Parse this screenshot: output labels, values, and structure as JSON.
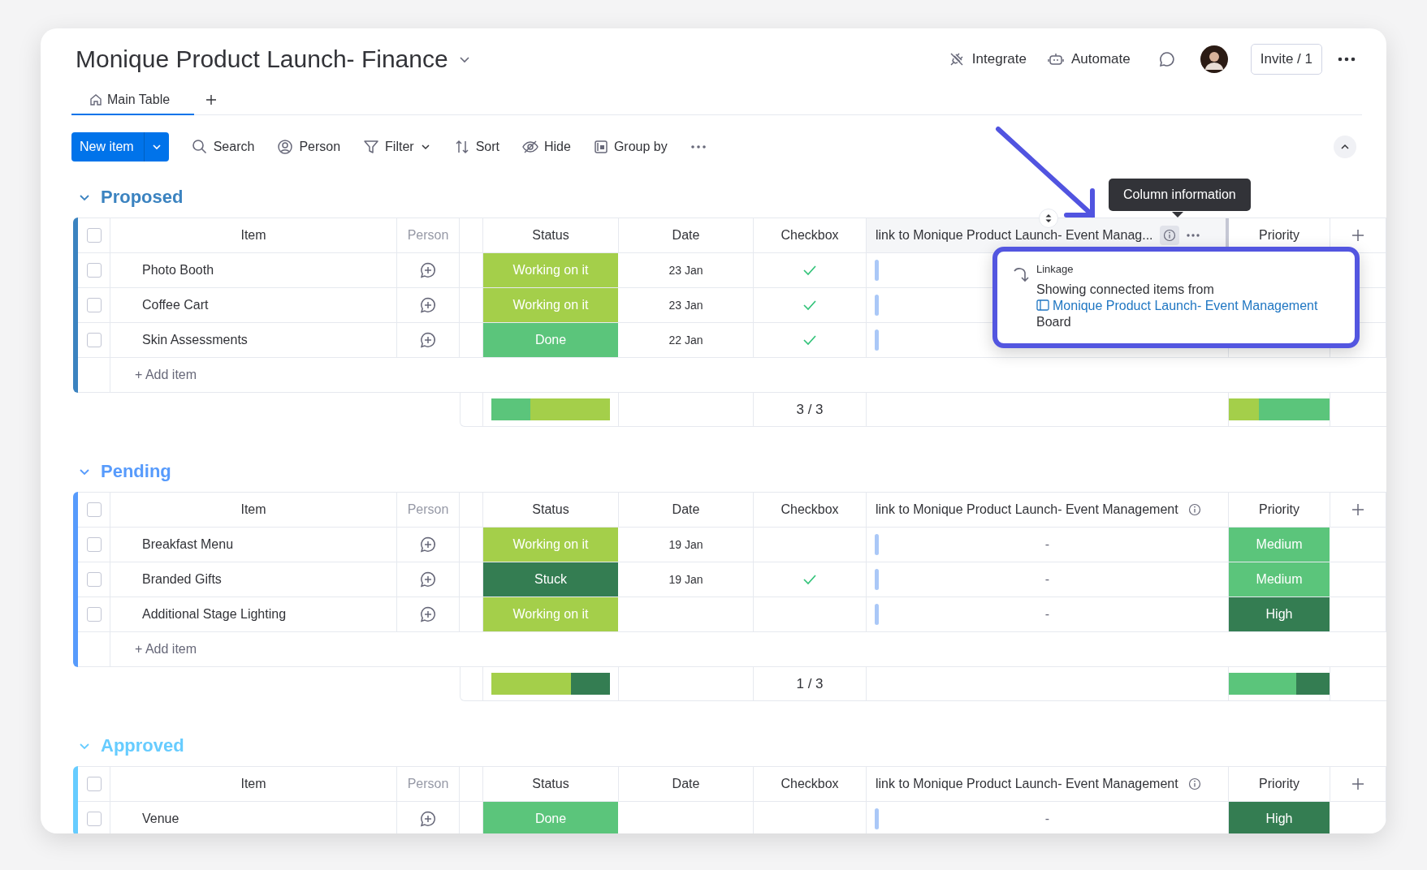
{
  "header": {
    "title": "Monique Product Launch- Finance",
    "actions": [
      {
        "kind": "integrate",
        "label": "Integrate"
      },
      {
        "kind": "automate",
        "label": "Automate"
      }
    ],
    "invite": "Invite / 1"
  },
  "tabs": [
    {
      "label": "Main Table",
      "selected": true
    }
  ],
  "toolbar": {
    "new_item": "New item",
    "tools": [
      {
        "kind": "search",
        "label": "Search"
      },
      {
        "kind": "person",
        "label": "Person"
      },
      {
        "kind": "filter",
        "label": "Filter"
      },
      {
        "kind": "sort",
        "label": "Sort"
      },
      {
        "kind": "hide",
        "label": "Hide"
      },
      {
        "kind": "group",
        "label": "Group by"
      }
    ]
  },
  "groups": [
    {
      "name": "Proposed",
      "color": "#3b83c0",
      "expanded": true,
      "all_selected": false,
      "columns": [
        {
          "kind": "item",
          "label": "Item"
        },
        {
          "kind": "person",
          "label": "Person"
        },
        {
          "kind": "status",
          "label": "Status"
        },
        {
          "kind": "date",
          "label": "Date"
        },
        {
          "kind": "checkbox",
          "label": "Checkbox"
        },
        {
          "kind": "link",
          "label": "link to Monique Product Launch- Event Manag...",
          "hovered": true
        },
        {
          "kind": "priority",
          "label": "Priority"
        }
      ],
      "rows": [
        {
          "item": "Photo Booth",
          "selected": false,
          "status": {
            "label": "Working on it",
            "color": "#a4cf4a"
          },
          "date": "23 Jan",
          "checked": true
        },
        {
          "item": "Coffee Cart",
          "selected": false,
          "status": {
            "label": "Working on it",
            "color": "#a4cf4a"
          },
          "date": "23 Jan",
          "checked": true
        },
        {
          "item": "Skin Assessments",
          "selected": false,
          "status": {
            "label": "Done",
            "color": "#5bc57b"
          },
          "date": "22 Jan",
          "checked": true
        }
      ],
      "add_item": "+ Add item",
      "summary": {
        "status": [
          {
            "color": "#5bc57b",
            "level": 0.33
          },
          {
            "color": "#a4cf4a",
            "level": 0.67
          }
        ],
        "checkbox": "3 / 3",
        "priority": [
          {
            "color": "#a4cf4a",
            "level": 0.3
          },
          {
            "color": "#5bc57b",
            "level": 0.7
          }
        ]
      }
    },
    {
      "name": "Pending",
      "color": "#579bfc",
      "expanded": true,
      "all_selected": false,
      "columns": [
        {
          "kind": "item",
          "label": "Item"
        },
        {
          "kind": "person",
          "label": "Person"
        },
        {
          "kind": "status",
          "label": "Status"
        },
        {
          "kind": "date",
          "label": "Date"
        },
        {
          "kind": "checkbox",
          "label": "Checkbox"
        },
        {
          "kind": "link",
          "label": "link to Monique Product Launch- Event Management",
          "hovered": false
        },
        {
          "kind": "priority",
          "label": "Priority"
        }
      ],
      "rows": [
        {
          "item": "Breakfast Menu",
          "selected": false,
          "status": {
            "label": "Working on it",
            "color": "#a4cf4a"
          },
          "date": "19 Jan",
          "checked": false,
          "link": "-",
          "priority": {
            "label": "Medium",
            "color": "#5bc57b"
          }
        },
        {
          "item": "Branded Gifts",
          "selected": false,
          "status": {
            "label": "Stuck",
            "color": "#347d52"
          },
          "date": "19 Jan",
          "checked": true,
          "link": "-",
          "priority": {
            "label": "Medium",
            "color": "#5bc57b"
          }
        },
        {
          "item": "Additional Stage Lighting",
          "selected": false,
          "status": {
            "label": "Working on it",
            "color": "#a4cf4a"
          },
          "checked": false,
          "link": "-",
          "priority": {
            "label": "High",
            "color": "#347d52"
          }
        }
      ],
      "add_item": "+ Add item",
      "summary": {
        "status": [
          {
            "color": "#a4cf4a",
            "level": 0.67
          },
          {
            "color": "#347d52",
            "level": 0.33
          }
        ],
        "checkbox": "1 / 3",
        "priority": [
          {
            "color": "#5bc57b",
            "level": 0.67
          },
          {
            "color": "#347d52",
            "level": 0.33
          }
        ]
      }
    },
    {
      "name": "Approved",
      "color": "#66ccff",
      "expanded": true,
      "all_selected": false,
      "columns": [
        {
          "kind": "item",
          "label": "Item"
        },
        {
          "kind": "person",
          "label": "Person"
        },
        {
          "kind": "status",
          "label": "Status"
        },
        {
          "kind": "date",
          "label": "Date"
        },
        {
          "kind": "checkbox",
          "label": "Checkbox"
        },
        {
          "kind": "link",
          "label": "link to Monique Product Launch- Event Management",
          "hovered": false
        },
        {
          "kind": "priority",
          "label": "Priority"
        }
      ],
      "rows": [
        {
          "item": "Venue",
          "selected": false,
          "status": {
            "label": "Done",
            "color": "#5bc57b"
          },
          "checked": false,
          "link": "-",
          "priority": {
            "label": "High",
            "color": "#347d52"
          }
        }
      ]
    }
  ],
  "tooltip": "Column information",
  "popup": {
    "title": "Linkage",
    "text": "Showing connected items from",
    "link": "Monique Product Launch- Event Management",
    "suffix": "Board"
  }
}
